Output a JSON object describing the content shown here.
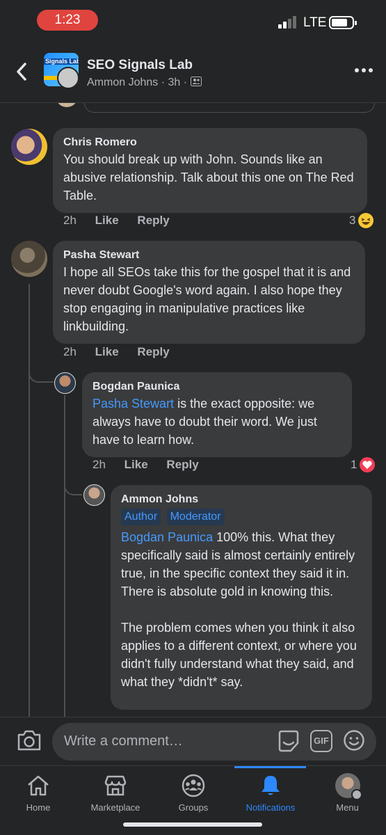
{
  "status_bar": {
    "time": "1:23",
    "network": "LTE"
  },
  "header": {
    "group_name": "SEO Signals Lab",
    "group_avatar_text": "Signals Lab",
    "poster": "Ammon Johns",
    "time_ago": "3h",
    "separator": "·"
  },
  "comments": [
    {
      "author": "Chris Romero",
      "text": "You should break up with John. Sounds like an abusive relationship. Talk about this one on The Red Table.",
      "time": "2h",
      "like": "Like",
      "reply": "Reply",
      "reaction_count": "3",
      "reaction_icon": "haha-emoji-icon"
    },
    {
      "author": "Pasha Stewart",
      "text": "I hope all SEOs take this for the gospel that it is and never doubt Google's word again. I also hope they stop engaging in manipulative practices like linkbuilding.",
      "time": "2h",
      "like": "Like",
      "reply": "Reply"
    },
    {
      "author": "Bogdan Paunica",
      "mention": "Pasha Stewart",
      "text": " is the exact opposite: we always have to doubt their word. We just have to learn how.",
      "time": "2h",
      "like": "Like",
      "reply": "Reply",
      "reaction_count": "1",
      "reaction_icon": "love-heart-icon"
    },
    {
      "author": "Ammon Johns",
      "badges": [
        "Author",
        "Moderator"
      ],
      "mention": "Bogdan Paunica",
      "text_p1": " 100% this.  What they specifically said is almost certainly entirely true, in the specific context they said it in.  There is absolute gold in knowing this.",
      "text_p2": "The problem comes when you think it also applies to a different context, or where you didn't fully understand what they said, and what they *didn't* say."
    }
  ],
  "composer": {
    "placeholder": "Write a comment…"
  },
  "tabs": [
    {
      "label": "Home",
      "icon": "home-icon"
    },
    {
      "label": "Marketplace",
      "icon": "marketplace-icon"
    },
    {
      "label": "Groups",
      "icon": "groups-icon"
    },
    {
      "label": "Notifications",
      "icon": "bell-icon",
      "active": true
    },
    {
      "label": "Menu",
      "icon": "menu-avatar-icon"
    }
  ],
  "colors": {
    "accent": "#2d88ff",
    "mention": "#4599ff",
    "bubble": "#3a3b3c",
    "background": "#242526",
    "status_pill": "#e0443e"
  }
}
